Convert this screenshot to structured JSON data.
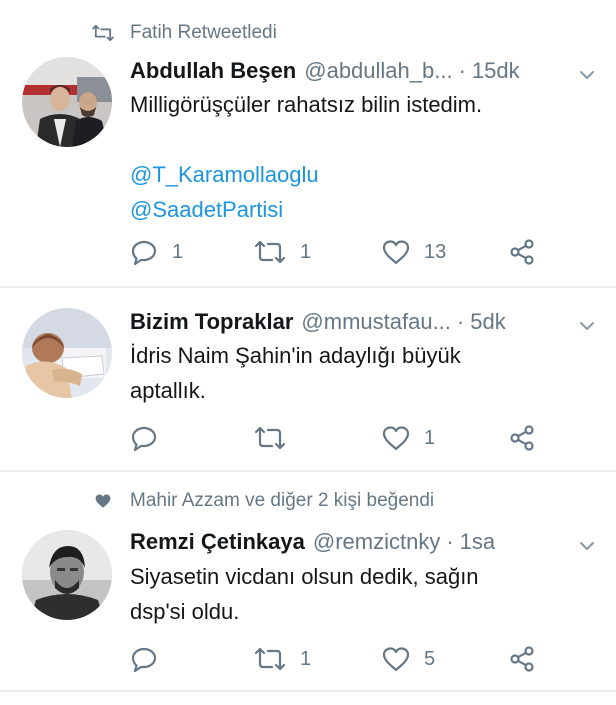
{
  "colors": {
    "text": "#14171a",
    "muted": "#657786",
    "link": "#1b95e0",
    "divider": "#e6ecf0"
  },
  "tweets": [
    {
      "social": {
        "icon": "retweet-icon",
        "text": "Fatih Retweetledi"
      },
      "name": "Abdullah Beşen",
      "handle": "@abdullah_b...",
      "time": "15dk",
      "lines": [
        "Milligörüşçüler rahatsız bilin istedim."
      ],
      "links": [
        "@T_Karamollaoglu",
        "@SaadetPartisi"
      ],
      "replies": "1",
      "retweets": "1",
      "likes": "13"
    },
    {
      "name": "Bizim Topraklar",
      "handle": "@mmustafau...",
      "time": "5dk",
      "lines": [
        "İdris Naim Şahin'in adaylığı büyük",
        "aptallık."
      ],
      "replies": "",
      "retweets": "",
      "likes": "1"
    },
    {
      "social": {
        "icon": "heart-icon",
        "text": "Mahir Azzam ve diğer 2 kişi beğendi"
      },
      "name": "Remzi Çetinkaya",
      "handle": "@remzictnky",
      "time": "1sa",
      "lines": [
        "Siyasetin vicdanı olsun dedik, sağın",
        "dsp'si oldu."
      ],
      "replies": "",
      "retweets": "1",
      "likes": "5"
    }
  ]
}
